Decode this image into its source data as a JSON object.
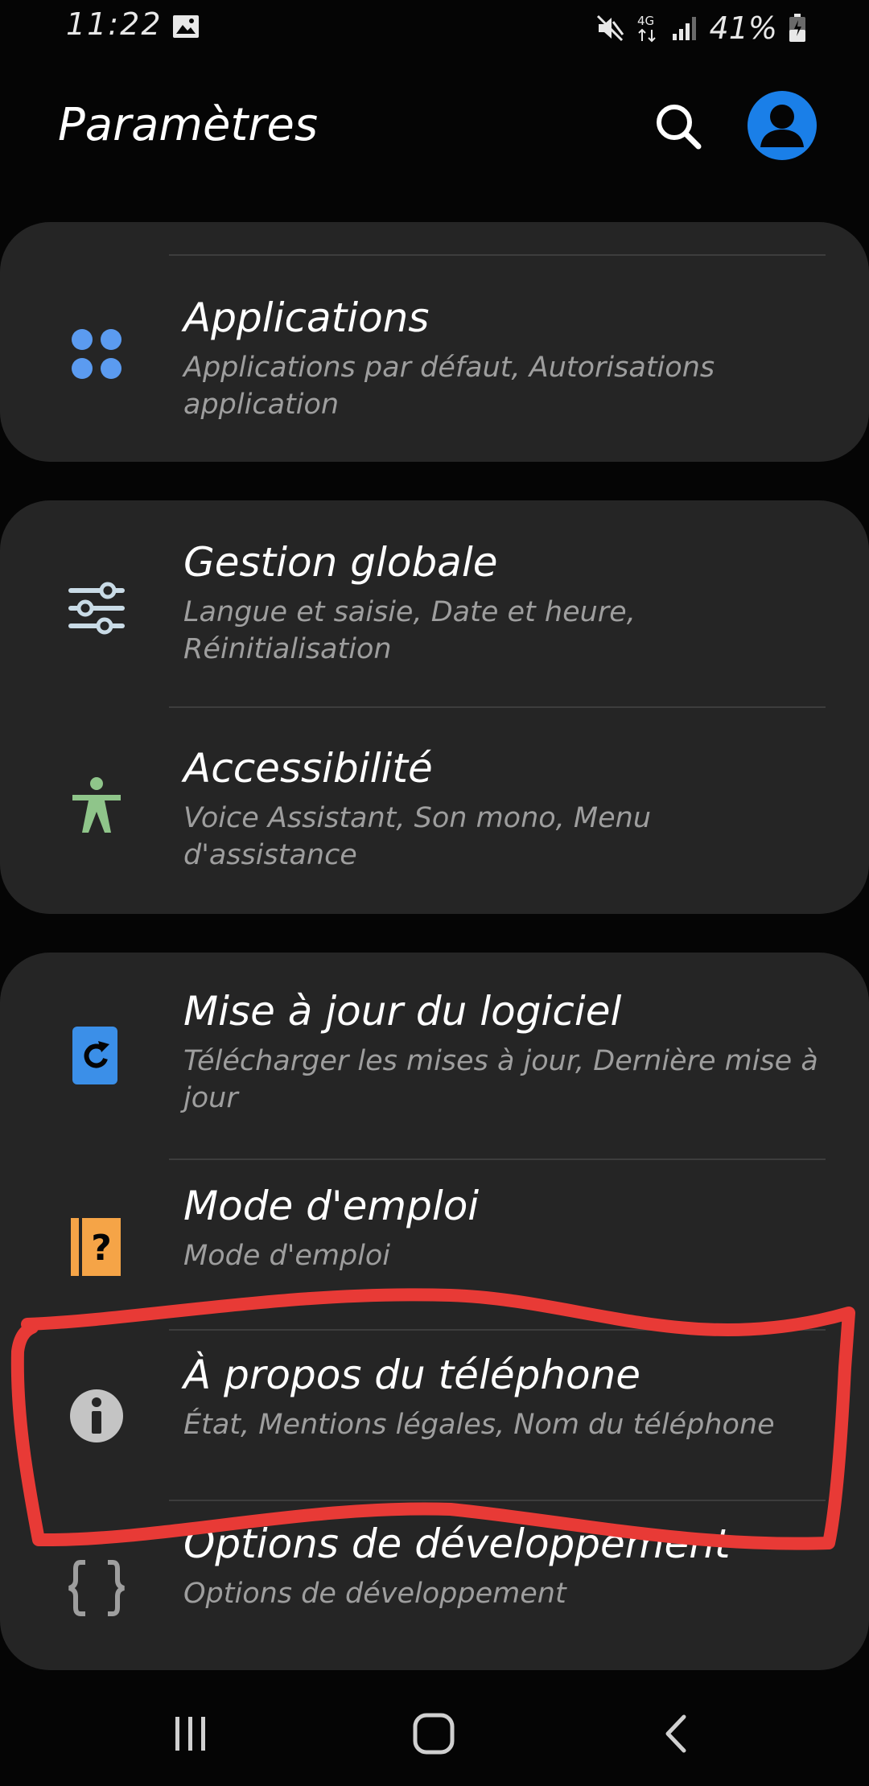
{
  "status_bar": {
    "time": "11:22",
    "battery": "41%",
    "network": "4G"
  },
  "header": {
    "title": "Paramètres"
  },
  "settings": {
    "applications": {
      "title": "Applications",
      "subtitle": "Applications par défaut, Autorisations application"
    },
    "general_management": {
      "title": "Gestion globale",
      "subtitle": "Langue et saisie, Date et heure, Réinitialisation"
    },
    "accessibility": {
      "title": "Accessibilité",
      "subtitle": "Voice Assistant, Son mono, Menu d'assistance"
    },
    "software_update": {
      "title": "Mise à jour du logiciel",
      "subtitle": "Télécharger les mises à jour, Dernière mise à jour"
    },
    "user_manual": {
      "title": "Mode d'emploi",
      "subtitle": "Mode d'emploi"
    },
    "about_phone": {
      "title": "À propos du téléphone",
      "subtitle": "État, Mentions légales, Nom du téléphone"
    },
    "developer_options": {
      "title": "Options de développement",
      "subtitle": "Options de développement"
    }
  },
  "icons": {
    "applications": "apps-grid-icon",
    "general_management": "sliders-icon",
    "accessibility": "accessibility-person-icon",
    "software_update": "update-icon",
    "user_manual": "manual-question-icon",
    "about_phone": "info-icon",
    "developer_options": "braces-icon"
  },
  "colors": {
    "background": "#050505",
    "card": "#252525",
    "accent_blue": "#1a7fe8",
    "apps_icon": "#5b9bf0",
    "sliders_icon": "#c9dbe6",
    "accessibility_icon": "#8fc58a",
    "update_icon": "#3b8fe8",
    "manual_icon": "#f5a447",
    "info_icon": "#c4c4c4",
    "braces_icon": "#9e9e9e",
    "highlight": "#e83a36"
  }
}
